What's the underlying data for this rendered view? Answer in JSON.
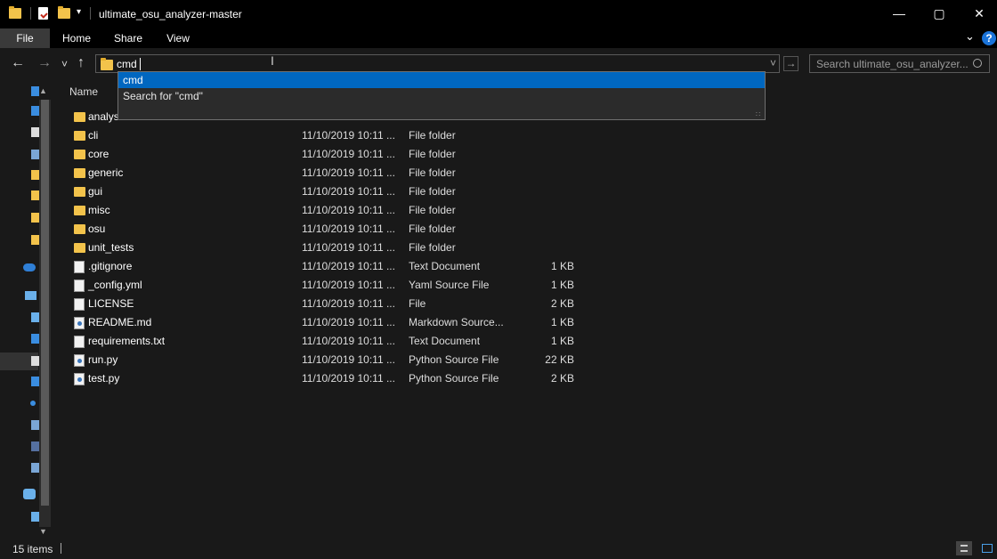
{
  "window": {
    "title": "ultimate_osu_analyzer-master",
    "minimize_glyph": "—",
    "maximize_glyph": "▢",
    "close_glyph": "✕"
  },
  "ribbon": {
    "tabs": [
      "File",
      "Home",
      "Share",
      "View"
    ],
    "help_glyph": "?",
    "expand_glyph": "⌄"
  },
  "nav": {
    "back_glyph": "←",
    "forward_glyph": "→",
    "recent_glyph": "˅",
    "up_glyph": "↑"
  },
  "address": {
    "value": "cmd",
    "go_glyph": "→",
    "dropdown_glyph": "˅"
  },
  "autocomplete": {
    "items": [
      "cmd",
      "Search for \"cmd\""
    ]
  },
  "search": {
    "placeholder": "Search ultimate_osu_analyzer..."
  },
  "filelist": {
    "column_name": "Name",
    "rows": [
      {
        "name": "analys",
        "date": "",
        "type": "",
        "size": "",
        "icon": "folder"
      },
      {
        "name": "cli",
        "date": "11/10/2019 10:11 ...",
        "type": "File folder",
        "size": "",
        "icon": "folder"
      },
      {
        "name": "core",
        "date": "11/10/2019 10:11 ...",
        "type": "File folder",
        "size": "",
        "icon": "folder"
      },
      {
        "name": "generic",
        "date": "11/10/2019 10:11 ...",
        "type": "File folder",
        "size": "",
        "icon": "folder"
      },
      {
        "name": "gui",
        "date": "11/10/2019 10:11 ...",
        "type": "File folder",
        "size": "",
        "icon": "folder"
      },
      {
        "name": "misc",
        "date": "11/10/2019 10:11 ...",
        "type": "File folder",
        "size": "",
        "icon": "folder"
      },
      {
        "name": "osu",
        "date": "11/10/2019 10:11 ...",
        "type": "File folder",
        "size": "",
        "icon": "folder"
      },
      {
        "name": "unit_tests",
        "date": "11/10/2019 10:11 ...",
        "type": "File folder",
        "size": "",
        "icon": "folder"
      },
      {
        "name": ".gitignore",
        "date": "11/10/2019 10:11 ...",
        "type": "Text Document",
        "size": "1 KB",
        "icon": "doc"
      },
      {
        "name": "_config.yml",
        "date": "11/10/2019 10:11 ...",
        "type": "Yaml Source File",
        "size": "1 KB",
        "icon": "doc"
      },
      {
        "name": "LICENSE",
        "date": "11/10/2019 10:11 ...",
        "type": "File",
        "size": "2 KB",
        "icon": "doc"
      },
      {
        "name": "README.md",
        "date": "11/10/2019 10:11 ...",
        "type": "Markdown Source...",
        "size": "1 KB",
        "icon": "py"
      },
      {
        "name": "requirements.txt",
        "date": "11/10/2019 10:11 ...",
        "type": "Text Document",
        "size": "1 KB",
        "icon": "doc"
      },
      {
        "name": "run.py",
        "date": "11/10/2019 10:11 ...",
        "type": "Python Source File",
        "size": "22 KB",
        "icon": "py"
      },
      {
        "name": "test.py",
        "date": "11/10/2019 10:11 ...",
        "type": "Python Source File",
        "size": "2 KB",
        "icon": "py"
      }
    ]
  },
  "status": {
    "item_count": "15 items"
  },
  "colors": {
    "accent": "#0067c0",
    "folder": "#f3c34b",
    "background": "#191919"
  }
}
